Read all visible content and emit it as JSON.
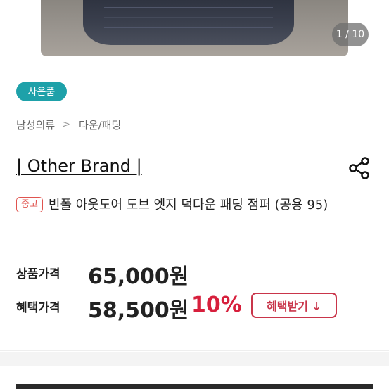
{
  "gallery": {
    "counter": "1 / 10"
  },
  "gift_badge": "사은품",
  "breadcrumb": {
    "level1": "남성의류",
    "level2": "다운/패딩"
  },
  "brand": "| Other Brand |",
  "condition_badge": "중고",
  "product_title": "빈폴 아웃도어 도브 엣지 덕다운 패딩 점퍼 (공용 95)",
  "price": {
    "label": "상품가격",
    "value": "65,000원"
  },
  "benefit_price": {
    "label": "혜택가격",
    "value": "58,500원",
    "discount": "10%",
    "button_label": "혜택받기 ↓"
  },
  "colors": {
    "gift_badge": "#1ea1a9",
    "discount": "#d71f3c",
    "condition": "#e0544f"
  },
  "icons": {
    "share": "share-icon"
  }
}
